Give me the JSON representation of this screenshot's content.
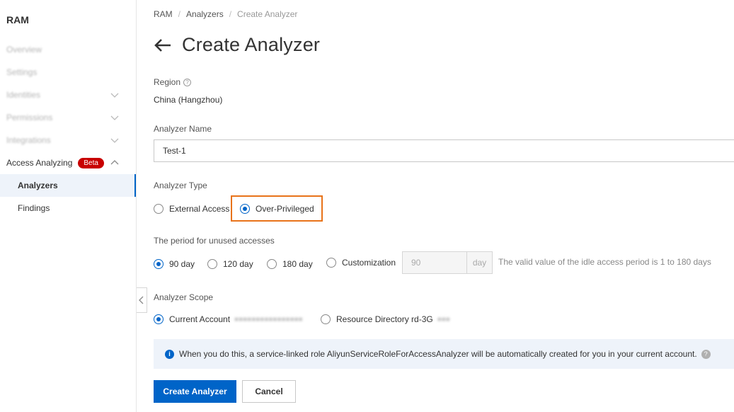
{
  "sidebar": {
    "brand": "RAM",
    "items": [
      {
        "label": "Overview"
      },
      {
        "label": "Settings"
      },
      {
        "label": "Identities"
      },
      {
        "label": "Permissions"
      },
      {
        "label": "Integrations"
      },
      {
        "label": "Access Analyzing",
        "badge": "Beta"
      },
      {
        "label": "Analyzers"
      },
      {
        "label": "Findings"
      }
    ]
  },
  "breadcrumb": [
    "RAM",
    "Analyzers",
    "Create Analyzer"
  ],
  "page_title": "Create Analyzer",
  "form": {
    "region_label": "Region",
    "region_value": "China (Hangzhou)",
    "name_label": "Analyzer Name",
    "name_value": "Test-1",
    "type_label": "Analyzer Type",
    "type_options": [
      "External Access",
      "Over-Privileged"
    ],
    "type_selected": "Over-Privileged",
    "period_label": "The period for unused accesses",
    "period_options": [
      "90 day",
      "120 day",
      "180 day",
      "Customization"
    ],
    "period_selected": "90 day",
    "custom_placeholder": "90",
    "custom_unit": "day",
    "period_hint": "The valid value of the idle access period is 1 to 180 days",
    "scope_label": "Analyzer Scope",
    "scope_options": [
      "Current Account",
      "Resource Directory rd-3G"
    ],
    "scope_selected": "Current Account"
  },
  "info_message": "When you do this, a service-linked role AliyunServiceRoleForAccessAnalyzer will be automatically created for you in your current account.",
  "buttons": {
    "create": "Create Analyzer",
    "cancel": "Cancel"
  },
  "colors": {
    "primary": "#0064c8",
    "highlight": "#e8731a",
    "beta_badge": "#c80000"
  }
}
